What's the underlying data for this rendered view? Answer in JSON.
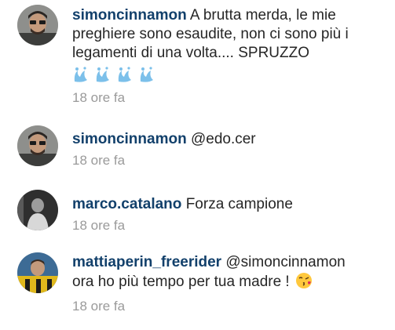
{
  "comments": [
    {
      "username": "simoncinnamon",
      "text_lines": [
        "A brutta merda, le mie",
        "preghiere sono esaudite, non ci sono più i",
        "legamenti di una volta.... SPRUZZO"
      ],
      "emoji": [
        "splash-icon",
        "splash-icon",
        "splash-icon",
        "splash-icon"
      ],
      "time": "18 ore fa"
    },
    {
      "username": "simoncinnamon",
      "text": "@edo.cer",
      "time": "18 ore fa"
    },
    {
      "username": "marco.catalano",
      "text": "Forza campione",
      "time": "18 ore fa"
    },
    {
      "username": "mattiaperin_freerider",
      "mention": "@simoncinnamon",
      "text_line2": "ora ho più tempo per tua madre !",
      "emoji": "kissing-face-icon",
      "time": "18 ore fa"
    }
  ],
  "colors": {
    "username": "#12406b",
    "text": "#262626",
    "time": "#9a9a9a"
  }
}
